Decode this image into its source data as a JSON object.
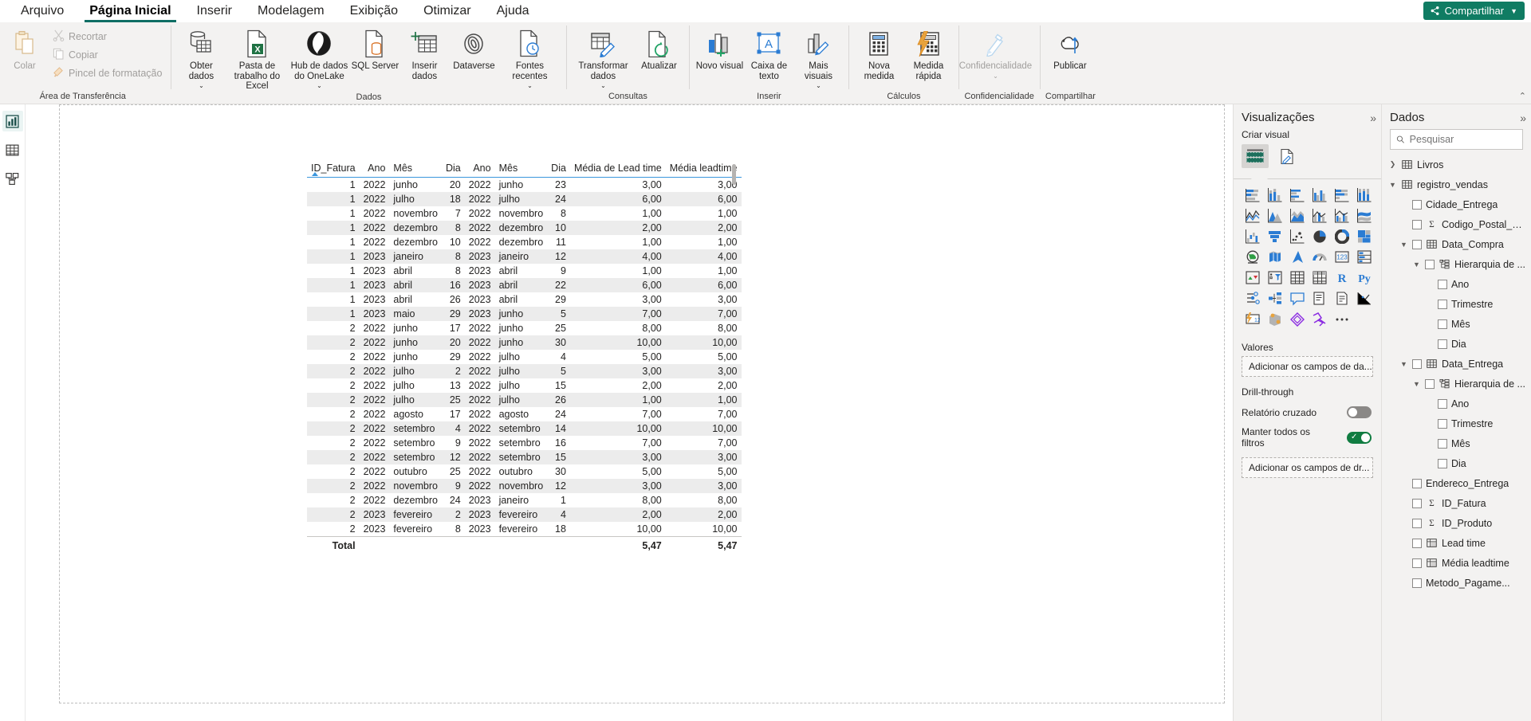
{
  "ribbon": {
    "tabs": [
      {
        "label": "Arquivo",
        "active": false
      },
      {
        "label": "Página Inicial",
        "active": true
      },
      {
        "label": "Inserir",
        "active": false
      },
      {
        "label": "Modelagem",
        "active": false
      },
      {
        "label": "Exibição",
        "active": false
      },
      {
        "label": "Otimizar",
        "active": false
      },
      {
        "label": "Ajuda",
        "active": false
      }
    ],
    "share_label": "Compartilhar",
    "collapse_label": "⌃",
    "groups": [
      {
        "name": "Área de Transferência",
        "big": [
          {
            "label": "Colar",
            "icon": "paste-icon",
            "disabled": true
          }
        ],
        "small": [
          {
            "label": "Recortar",
            "icon": "scissors-icon"
          },
          {
            "label": "Copiar",
            "icon": "copy-icon"
          },
          {
            "label": "Pincel de formatação",
            "icon": "format-painter-icon"
          }
        ]
      },
      {
        "name": "Dados",
        "big": [
          {
            "label": "Obter dados",
            "icon": "get-data-icon",
            "caret": true
          },
          {
            "label": "Pasta de trabalho do Excel",
            "icon": "excel-icon",
            "caret": false
          },
          {
            "label": "Hub de dados do OneLake",
            "icon": "onelake-icon",
            "caret": true
          },
          {
            "label": "SQL Server",
            "icon": "sql-server-icon",
            "caret": false
          },
          {
            "label": "Inserir dados",
            "icon": "enter-data-icon",
            "caret": false
          },
          {
            "label": "Dataverse",
            "icon": "dataverse-icon",
            "caret": false
          },
          {
            "label": "Fontes recentes",
            "icon": "recent-sources-icon",
            "caret": true
          }
        ],
        "small": []
      },
      {
        "name": "Consultas",
        "big": [
          {
            "label": "Transformar dados",
            "icon": "transform-data-icon",
            "caret": true
          },
          {
            "label": "Atualizar",
            "icon": "refresh-icon",
            "caret": false
          }
        ],
        "small": []
      },
      {
        "name": "Inserir",
        "big": [
          {
            "label": "Novo visual",
            "icon": "new-visual-icon",
            "caret": false
          },
          {
            "label": "Caixa de texto",
            "icon": "text-box-icon",
            "caret": false
          },
          {
            "label": "Mais visuais",
            "icon": "more-visuals-icon",
            "caret": true
          }
        ],
        "small": []
      },
      {
        "name": "Cálculos",
        "big": [
          {
            "label": "Nova medida",
            "icon": "new-measure-icon",
            "caret": false
          },
          {
            "label": "Medida rápida",
            "icon": "quick-measure-icon",
            "caret": false
          }
        ],
        "small": []
      },
      {
        "name": "Confidencialidade",
        "big": [
          {
            "label": "Confidencialidade",
            "icon": "sensitivity-icon",
            "caret": true,
            "disabled": true
          }
        ],
        "small": []
      },
      {
        "name": "Compartilhar",
        "big": [
          {
            "label": "Publicar",
            "icon": "publish-icon",
            "caret": false
          }
        ],
        "small": []
      }
    ]
  },
  "left_rail": [
    {
      "name": "report-view",
      "icon": "report-icon",
      "active": true
    },
    {
      "name": "table-view",
      "icon": "table-icon",
      "active": false
    },
    {
      "name": "model-view",
      "icon": "model-icon",
      "active": false
    }
  ],
  "chart_data": {
    "type": "table",
    "title": "",
    "columns": [
      "ID_Fatura",
      "Ano",
      "Mês",
      "Dia",
      "Ano",
      "Mês",
      "Dia",
      "Média de Lead time",
      "Média leadtime"
    ],
    "column_align": [
      "right",
      "right",
      "left",
      "right",
      "right",
      "left",
      "right",
      "right",
      "right"
    ],
    "sorted_column": "ID_Fatura",
    "sort_direction": "asc",
    "rows": [
      [
        "1",
        "2022",
        "junho",
        "20",
        "2022",
        "junho",
        "23",
        "3,00",
        "3,00"
      ],
      [
        "1",
        "2022",
        "julho",
        "18",
        "2022",
        "julho",
        "24",
        "6,00",
        "6,00"
      ],
      [
        "1",
        "2022",
        "novembro",
        "7",
        "2022",
        "novembro",
        "8",
        "1,00",
        "1,00"
      ],
      [
        "1",
        "2022",
        "dezembro",
        "8",
        "2022",
        "dezembro",
        "10",
        "2,00",
        "2,00"
      ],
      [
        "1",
        "2022",
        "dezembro",
        "10",
        "2022",
        "dezembro",
        "11",
        "1,00",
        "1,00"
      ],
      [
        "1",
        "2023",
        "janeiro",
        "8",
        "2023",
        "janeiro",
        "12",
        "4,00",
        "4,00"
      ],
      [
        "1",
        "2023",
        "abril",
        "8",
        "2023",
        "abril",
        "9",
        "1,00",
        "1,00"
      ],
      [
        "1",
        "2023",
        "abril",
        "16",
        "2023",
        "abril",
        "22",
        "6,00",
        "6,00"
      ],
      [
        "1",
        "2023",
        "abril",
        "26",
        "2023",
        "abril",
        "29",
        "3,00",
        "3,00"
      ],
      [
        "1",
        "2023",
        "maio",
        "29",
        "2023",
        "junho",
        "5",
        "7,00",
        "7,00"
      ],
      [
        "2",
        "2022",
        "junho",
        "17",
        "2022",
        "junho",
        "25",
        "8,00",
        "8,00"
      ],
      [
        "2",
        "2022",
        "junho",
        "20",
        "2022",
        "junho",
        "30",
        "10,00",
        "10,00"
      ],
      [
        "2",
        "2022",
        "junho",
        "29",
        "2022",
        "julho",
        "4",
        "5,00",
        "5,00"
      ],
      [
        "2",
        "2022",
        "julho",
        "2",
        "2022",
        "julho",
        "5",
        "3,00",
        "3,00"
      ],
      [
        "2",
        "2022",
        "julho",
        "13",
        "2022",
        "julho",
        "15",
        "2,00",
        "2,00"
      ],
      [
        "2",
        "2022",
        "julho",
        "25",
        "2022",
        "julho",
        "26",
        "1,00",
        "1,00"
      ],
      [
        "2",
        "2022",
        "agosto",
        "17",
        "2022",
        "agosto",
        "24",
        "7,00",
        "7,00"
      ],
      [
        "2",
        "2022",
        "setembro",
        "4",
        "2022",
        "setembro",
        "14",
        "10,00",
        "10,00"
      ],
      [
        "2",
        "2022",
        "setembro",
        "9",
        "2022",
        "setembro",
        "16",
        "7,00",
        "7,00"
      ],
      [
        "2",
        "2022",
        "setembro",
        "12",
        "2022",
        "setembro",
        "15",
        "3,00",
        "3,00"
      ],
      [
        "2",
        "2022",
        "outubro",
        "25",
        "2022",
        "outubro",
        "30",
        "5,00",
        "5,00"
      ],
      [
        "2",
        "2022",
        "novembro",
        "9",
        "2022",
        "novembro",
        "12",
        "3,00",
        "3,00"
      ],
      [
        "2",
        "2022",
        "dezembro",
        "24",
        "2023",
        "janeiro",
        "1",
        "8,00",
        "8,00"
      ],
      [
        "2",
        "2023",
        "fevereiro",
        "2",
        "2023",
        "fevereiro",
        "4",
        "2,00",
        "2,00"
      ],
      [
        "2",
        "2023",
        "fevereiro",
        "8",
        "2023",
        "fevereiro",
        "18",
        "10,00",
        "10,00"
      ]
    ],
    "total_row": [
      "Total",
      "",
      "",
      "",
      "",
      "",
      "",
      "5,47",
      "5,47"
    ],
    "total_label": "Total"
  },
  "viz_pane": {
    "title": "Visualizações",
    "expand_icon": "chevrons-right-icon",
    "create_visual_label": "Criar visual",
    "type_buttons": [
      {
        "name": "build-visual-icon",
        "selected": true
      },
      {
        "name": "format-visual-icon",
        "selected": false
      }
    ],
    "gallery": [
      "stacked-bar-chart",
      "stacked-column-chart",
      "clustered-bar-chart",
      "clustered-column-chart",
      "100-stacked-bar-chart",
      "100-stacked-column-chart",
      "line-chart",
      "area-chart",
      "stacked-area-chart",
      "line-stacked-column-chart",
      "line-clustered-column-chart",
      "ribbon-chart",
      "waterfall-chart",
      "funnel-chart",
      "scatter-chart",
      "pie-chart",
      "donut-chart",
      "treemap",
      "map",
      "filled-map",
      "azure-map",
      "gauge-chart",
      "card",
      "multi-row-card",
      "kpi",
      "slicer",
      "table",
      "matrix",
      "r-script-visual",
      "python-visual",
      "key-influencers",
      "decomposition-tree",
      "q-and-a",
      "narrative",
      "paginated-report",
      "metrics",
      "ai-visual",
      "arcgis-map",
      "power-apps",
      "power-automate",
      "more-options",
      ""
    ],
    "values_label": "Valores",
    "values_placeholder": "Adicionar os campos de da...",
    "drillthrough_label": "Drill-through",
    "cross_report_label": "Relatório cruzado",
    "cross_report_on": false,
    "keep_all_filters_label": "Manter todos os filtros",
    "keep_all_filters_on": true,
    "drill_placeholder": "Adicionar os campos de dr..."
  },
  "data_pane": {
    "title": "Dados",
    "expand_icon": "chevrons-right-icon",
    "search_placeholder": "Pesquisar",
    "search_value": "",
    "search_icon": "search-icon",
    "tree": [
      {
        "label": "Livros",
        "level": 0,
        "type": "table",
        "expanded": false,
        "checkbox": false
      },
      {
        "label": "registro_vendas",
        "level": 0,
        "type": "table",
        "expanded": true,
        "checkbox": false
      },
      {
        "label": "Cidade_Entrega",
        "level": 1,
        "type": "field",
        "expanded": null,
        "checkbox": true
      },
      {
        "label": "Codigo_Postal_E...",
        "level": 1,
        "type": "sigma",
        "expanded": null,
        "checkbox": true
      },
      {
        "label": "Data_Compra",
        "level": 1,
        "type": "table",
        "expanded": true,
        "checkbox": true
      },
      {
        "label": "Hierarquia de ...",
        "level": 2,
        "type": "hierarchy",
        "expanded": true,
        "checkbox": true
      },
      {
        "label": "Ano",
        "level": 3,
        "type": "field",
        "expanded": null,
        "checkbox": true
      },
      {
        "label": "Trimestre",
        "level": 3,
        "type": "field",
        "expanded": null,
        "checkbox": true
      },
      {
        "label": "Mês",
        "level": 3,
        "type": "field",
        "expanded": null,
        "checkbox": true
      },
      {
        "label": "Dia",
        "level": 3,
        "type": "field",
        "expanded": null,
        "checkbox": true
      },
      {
        "label": "Data_Entrega",
        "level": 1,
        "type": "table",
        "expanded": true,
        "checkbox": true
      },
      {
        "label": "Hierarquia de ...",
        "level": 2,
        "type": "hierarchy",
        "expanded": true,
        "checkbox": true
      },
      {
        "label": "Ano",
        "level": 3,
        "type": "field",
        "expanded": null,
        "checkbox": true
      },
      {
        "label": "Trimestre",
        "level": 3,
        "type": "field",
        "expanded": null,
        "checkbox": true
      },
      {
        "label": "Mês",
        "level": 3,
        "type": "field",
        "expanded": null,
        "checkbox": true
      },
      {
        "label": "Dia",
        "level": 3,
        "type": "field",
        "expanded": null,
        "checkbox": true
      },
      {
        "label": "Endereco_Entrega",
        "level": 1,
        "type": "field",
        "expanded": null,
        "checkbox": true
      },
      {
        "label": "ID_Fatura",
        "level": 1,
        "type": "sigma",
        "expanded": null,
        "checkbox": true
      },
      {
        "label": "ID_Produto",
        "level": 1,
        "type": "sigma",
        "expanded": null,
        "checkbox": true
      },
      {
        "label": "Lead time",
        "level": 1,
        "type": "measure",
        "expanded": null,
        "checkbox": true
      },
      {
        "label": "Média leadtime",
        "level": 1,
        "type": "measure",
        "expanded": null,
        "checkbox": true
      },
      {
        "label": "Metodo_Pagame...",
        "level": 1,
        "type": "field",
        "expanded": null,
        "checkbox": true
      }
    ]
  },
  "colors": {
    "accent": "#107c63",
    "tab_underline": "#0f6e64",
    "header_rule": "#3a96dd",
    "toggle_on": "#107c41",
    "pane_bg": "#f3f2f1"
  }
}
